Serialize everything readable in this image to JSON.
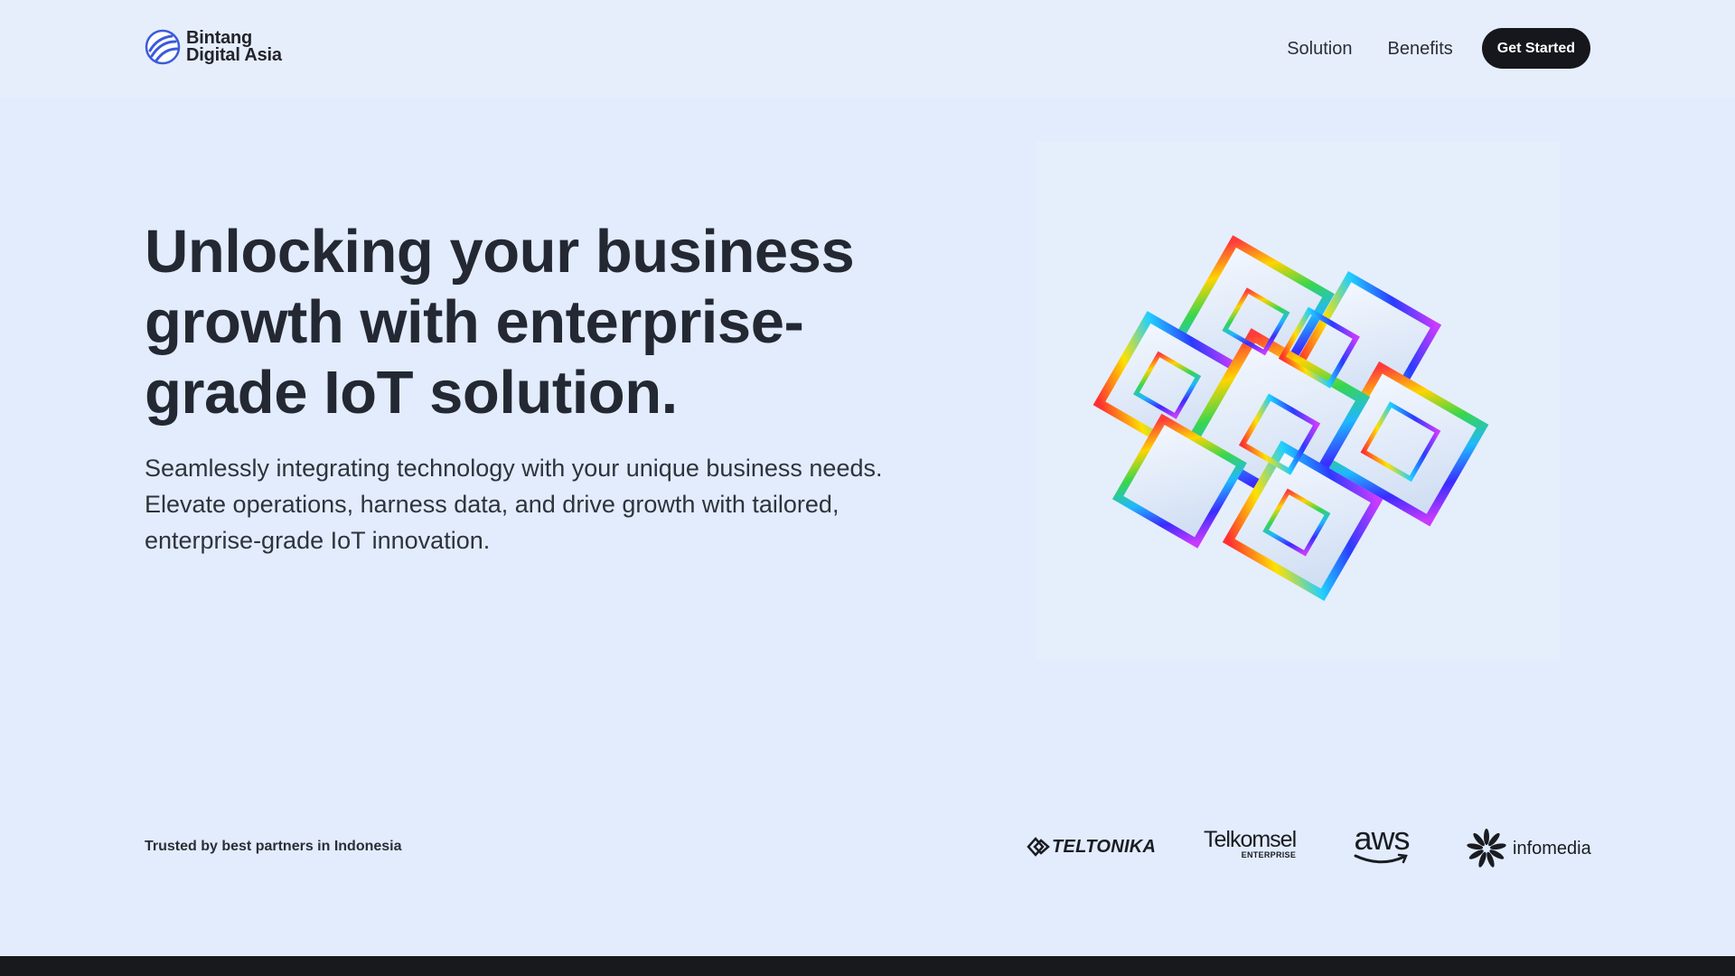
{
  "header": {
    "brand_line1": "Bintang",
    "brand_line2": "Digital Asia",
    "nav": [
      {
        "label": "Solution"
      },
      {
        "label": "Benefits"
      }
    ],
    "cta_label": "Get Started"
  },
  "hero": {
    "title": "Unlocking your business growth with enterprise-grade IoT solution.",
    "subtitle": "Seamlessly integrating technology with your unique business needs. Elevate operations, harness data, and drive growth with tailored, enterprise-grade IoT innovation."
  },
  "partners": {
    "label": "Trusted by best partners in Indonesia",
    "logos": [
      {
        "name": "TELTONIKA"
      },
      {
        "name": "Telkomsel",
        "sub": "ENTERPRISE"
      },
      {
        "name": "aws"
      },
      {
        "name": "infomedia"
      }
    ]
  },
  "colors": {
    "background": "#e2ecfc",
    "text": "#232833",
    "cta_bg": "#15171c",
    "brand_blue": "#3b5bdb",
    "footer": "#18191c"
  },
  "icons": {
    "brand": "globe-logo-icon",
    "hero_art": "iridescent-cube-cluster"
  }
}
